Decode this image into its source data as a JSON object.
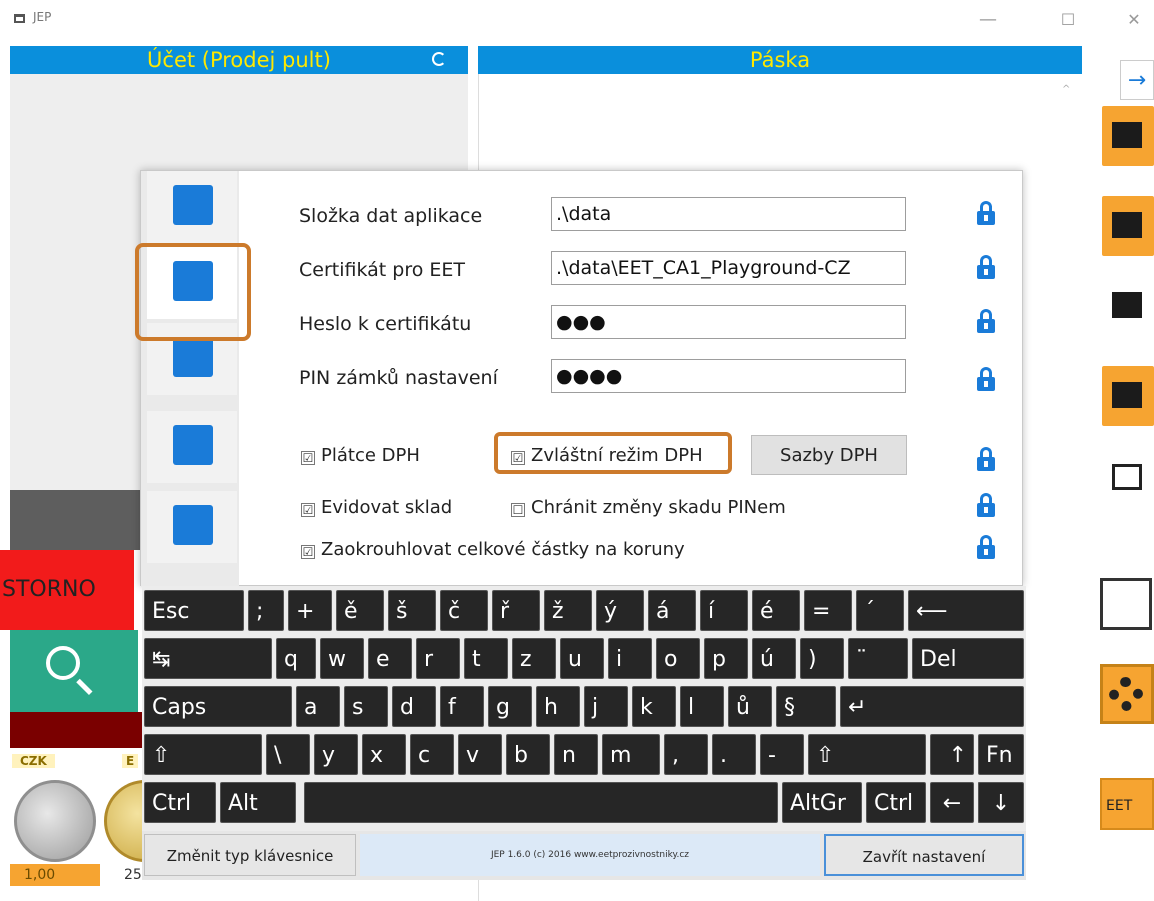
{
  "window": {
    "title": "JEP",
    "minimize": "—",
    "maximize": "☐",
    "close": "✕"
  },
  "account_panel": {
    "title": "Účet (Prodej pult)",
    "storno": "STORNO"
  },
  "currency": {
    "labels": [
      "CZK",
      "E"
    ],
    "values": [
      "1,00",
      "25"
    ]
  },
  "tape_panel": {
    "title": "Páska"
  },
  "right_toolbar": {
    "arrow": "→",
    "eet": "EET"
  },
  "settings": {
    "app_data_folder": {
      "label": "Složka dat aplikace",
      "value": ".\\data"
    },
    "certificate": {
      "label": "Certifikát pro EET",
      "value": ".\\data\\EET_CA1_Playground-CZ"
    },
    "cert_password": {
      "label": "Heslo k certifikátu",
      "value": "●●●"
    },
    "settings_pin": {
      "label": "PIN zámků nastavení",
      "value": "●●●●"
    },
    "vat_payer": {
      "label": "Plátce DPH",
      "checked": true
    },
    "special_vat": {
      "label": "Zvláštní režim DPH",
      "checked": true
    },
    "vat_rates_button": "Sazby DPH",
    "track_stock": {
      "label": "Evidovat sklad",
      "checked": true
    },
    "protect_stock_pin": {
      "label": "Chránit změny skadu PINem",
      "checked": false
    },
    "round_totals": {
      "label": "Zaokrouhlovat celkové částky na koruny",
      "checked": true
    },
    "check_glyph": "☑",
    "uncheck_glyph": "☐"
  },
  "keyboard": {
    "row1": [
      "Esc",
      ";",
      "+",
      "ě",
      "š",
      "č",
      "ř",
      "ž",
      "ý",
      "á",
      "í",
      "é",
      "=",
      "´",
      "⟵"
    ],
    "row2": [
      "↹",
      "q",
      "w",
      "e",
      "r",
      "t",
      "z",
      "u",
      "i",
      "o",
      "p",
      "ú",
      ")",
      "¨",
      "Del"
    ],
    "row3": [
      "Caps",
      "a",
      "s",
      "d",
      "f",
      "g",
      "h",
      "j",
      "k",
      "l",
      "ů",
      "§",
      "↵"
    ],
    "row4": [
      "⇧",
      "\\",
      "y",
      "x",
      "c",
      "v",
      "b",
      "n",
      "m",
      ",",
      ".",
      "-",
      "⇧",
      "↑",
      "Fn"
    ],
    "row5": [
      "Ctrl",
      "Alt",
      "",
      "AltGr",
      "Ctrl",
      "←",
      "↓",
      "→"
    ],
    "change_type": "Změnit typ klávesnice",
    "info": "JEP 1.6.0 (c) 2016 www.eetprozivnostniky.cz",
    "close_settings": "Zavřít nastavení"
  }
}
